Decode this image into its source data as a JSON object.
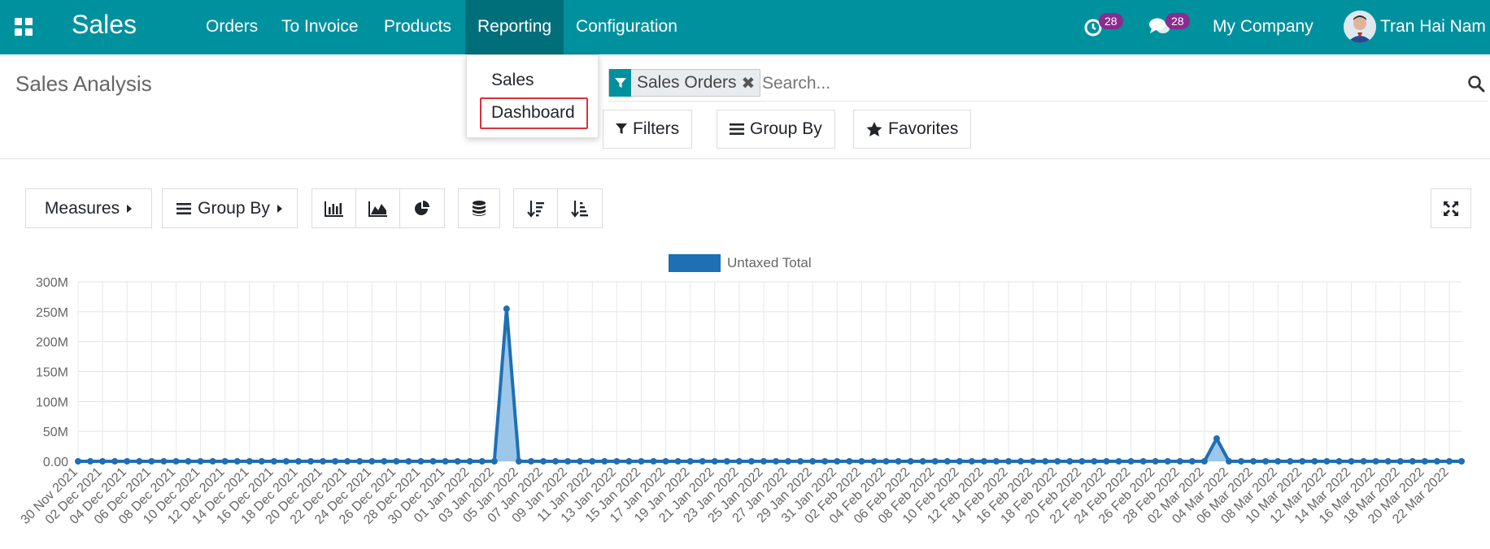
{
  "navbar": {
    "app_title": "Sales",
    "menu": [
      "Orders",
      "To Invoice",
      "Products",
      "Reporting",
      "Configuration"
    ],
    "active_menu": "Reporting",
    "activity_count": "28",
    "message_count": "28",
    "company": "My Company",
    "user": "Tran Hai Nam",
    "bg_color": "#00919f"
  },
  "reporting_menu": {
    "items": [
      "Sales",
      "Dashboard"
    ],
    "highlighted": "Dashboard"
  },
  "control_panel": {
    "title": "Sales Analysis",
    "facet_label": "Sales Orders",
    "search_placeholder": "Search...",
    "filters_label": "Filters",
    "groupby_label": "Group By",
    "favorites_label": "Favorites"
  },
  "toolbar": {
    "measures_label": "Measures",
    "groupby_label": "Group By"
  },
  "chart_data": {
    "type": "line",
    "legend": [
      "Untaxed Total"
    ],
    "ylabel": "",
    "xlabel": "",
    "ylim": [
      0,
      300000000
    ],
    "y_ticks": [
      "0.00",
      "50M",
      "100M",
      "150M",
      "200M",
      "250M",
      "300M"
    ],
    "series_color": "#1f6fb4",
    "fill_color": "#91c1e6",
    "grid": true,
    "x": [
      "30 Nov 2021",
      "01 Dec 2021",
      "02 Dec 2021",
      "03 Dec 2021",
      "04 Dec 2021",
      "05 Dec 2021",
      "06 Dec 2021",
      "07 Dec 2021",
      "08 Dec 2021",
      "09 Dec 2021",
      "10 Dec 2021",
      "11 Dec 2021",
      "12 Dec 2021",
      "13 Dec 2021",
      "14 Dec 2021",
      "15 Dec 2021",
      "16 Dec 2021",
      "17 Dec 2021",
      "18 Dec 2021",
      "19 Dec 2021",
      "20 Dec 2021",
      "21 Dec 2021",
      "22 Dec 2021",
      "23 Dec 2021",
      "24 Dec 2021",
      "25 Dec 2021",
      "26 Dec 2021",
      "27 Dec 2021",
      "28 Dec 2021",
      "29 Dec 2021",
      "30 Dec 2021",
      "31 Dec 2021",
      "01 Jan 2022",
      "02 Jan 2022",
      "03 Jan 2022",
      "04 Jan 2022",
      "05 Jan 2022",
      "06 Jan 2022",
      "07 Jan 2022",
      "08 Jan 2022",
      "09 Jan 2022",
      "10 Jan 2022",
      "11 Jan 2022",
      "12 Jan 2022",
      "13 Jan 2022",
      "14 Jan 2022",
      "15 Jan 2022",
      "16 Jan 2022",
      "17 Jan 2022",
      "18 Jan 2022",
      "19 Jan 2022",
      "20 Jan 2022",
      "21 Jan 2022",
      "22 Jan 2022",
      "23 Jan 2022",
      "24 Jan 2022",
      "25 Jan 2022",
      "26 Jan 2022",
      "27 Jan 2022",
      "28 Jan 2022",
      "29 Jan 2022",
      "30 Jan 2022",
      "31 Jan 2022",
      "01 Feb 2022",
      "02 Feb 2022",
      "03 Feb 2022",
      "04 Feb 2022",
      "05 Feb 2022",
      "06 Feb 2022",
      "07 Feb 2022",
      "08 Feb 2022",
      "09 Feb 2022",
      "10 Feb 2022",
      "11 Feb 2022",
      "12 Feb 2022",
      "13 Feb 2022",
      "14 Feb 2022",
      "15 Feb 2022",
      "16 Feb 2022",
      "17 Feb 2022",
      "18 Feb 2022",
      "19 Feb 2022",
      "20 Feb 2022",
      "21 Feb 2022",
      "22 Feb 2022",
      "23 Feb 2022",
      "24 Feb 2022",
      "25 Feb 2022",
      "26 Feb 2022",
      "27 Feb 2022",
      "28 Feb 2022",
      "01 Mar 2022",
      "02 Mar 2022",
      "03 Mar 2022",
      "04 Mar 2022",
      "05 Mar 2022",
      "06 Mar 2022",
      "07 Mar 2022",
      "08 Mar 2022",
      "09 Mar 2022",
      "10 Mar 2022",
      "11 Mar 2022",
      "12 Mar 2022",
      "13 Mar 2022",
      "14 Mar 2022",
      "15 Mar 2022",
      "16 Mar 2022",
      "17 Mar 2022",
      "18 Mar 2022",
      "19 Mar 2022",
      "20 Mar 2022",
      "21 Mar 2022",
      "22 Mar 2022",
      "23 Mar 2022"
    ],
    "spikes": {
      "04 Jan 2022": 255000000,
      "03 Mar 2022": 38000000
    },
    "label_every": 2
  }
}
